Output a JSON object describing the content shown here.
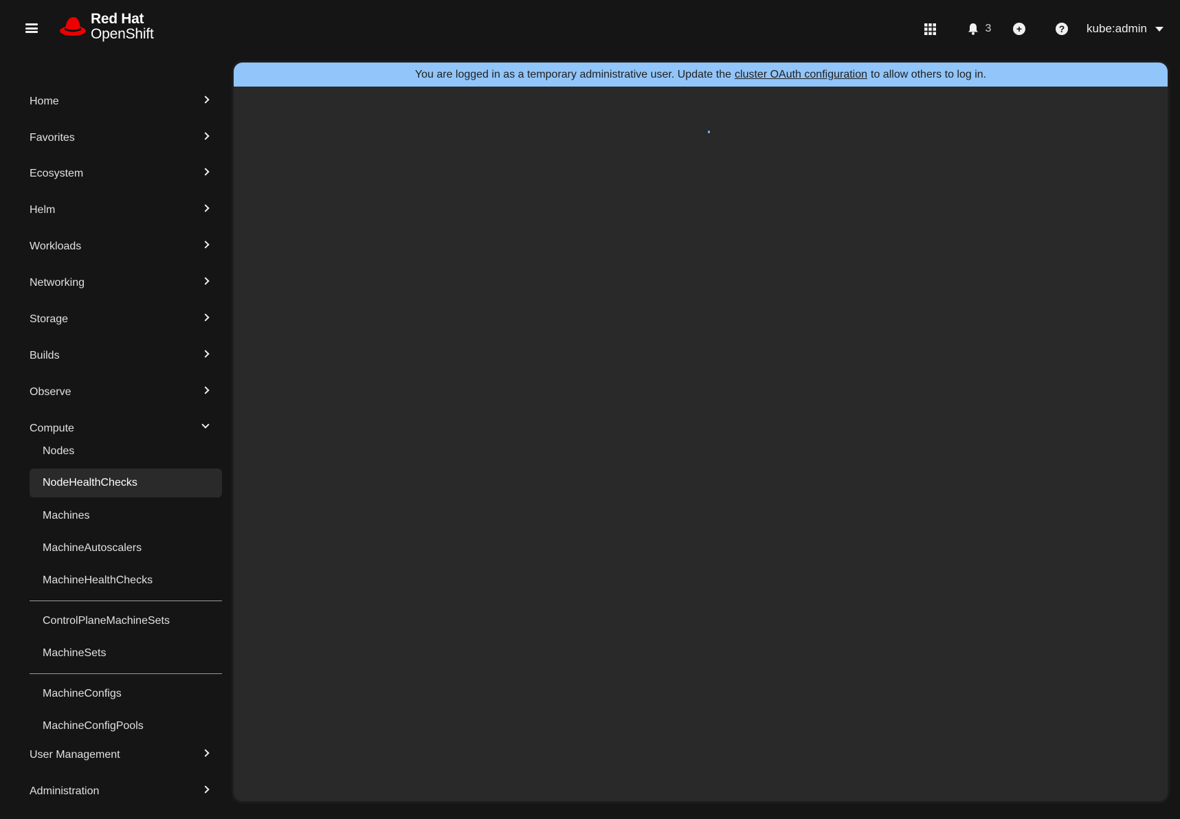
{
  "masthead": {
    "brand_line1": "Red Hat",
    "brand_line2": "OpenShift",
    "notification_count": "3",
    "user": "kube:admin",
    "brand_color": "#ee0000"
  },
  "banner": {
    "text_before": "You are logged in as a temporary administrative user. Update the",
    "link": "cluster OAuth configuration",
    "text_after": "to allow others to log in.",
    "color": "#92c5f9"
  },
  "sidebar": {
    "items": [
      {
        "label": "Home"
      },
      {
        "label": "Favorites"
      },
      {
        "label": "Ecosystem"
      },
      {
        "label": "Helm"
      },
      {
        "label": "Workloads"
      },
      {
        "label": "Networking"
      },
      {
        "label": "Storage"
      },
      {
        "label": "Builds"
      },
      {
        "label": "Observe"
      },
      {
        "label": "Compute"
      }
    ],
    "compute_children": [
      {
        "label": "Nodes"
      },
      {
        "label": "NodeHealthChecks"
      },
      {
        "label": "Machines"
      },
      {
        "label": "MachineAutoscalers"
      },
      {
        "label": "MachineHealthChecks"
      },
      {
        "label": "ControlPlaneMachineSets"
      },
      {
        "label": "MachineSets"
      },
      {
        "label": "MachineConfigs"
      },
      {
        "label": "MachineConfigPools"
      }
    ],
    "after": [
      {
        "label": "User Management"
      },
      {
        "label": "Administration"
      }
    ]
  }
}
